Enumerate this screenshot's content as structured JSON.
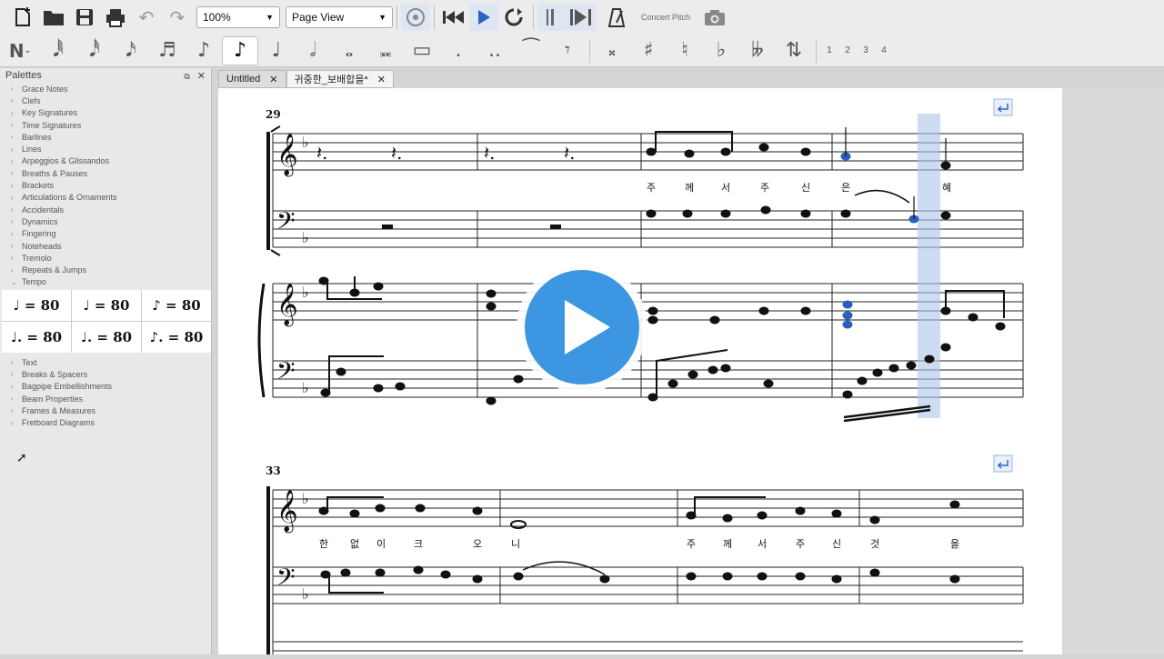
{
  "toolbar": {
    "zoom_value": "100%",
    "view_value": "Page View",
    "concert_pitch_label": "Concert Pitch",
    "voice_numbers": [
      "1",
      "2",
      "3",
      "4"
    ]
  },
  "palettes": {
    "title": "Palettes",
    "items_top": [
      "Grace Notes",
      "Clefs",
      "Key Signatures",
      "Time Signatures",
      "Barlines",
      "Lines",
      "Arpeggios & Glissandos",
      "Breaths & Pauses",
      "Brackets",
      "Articulations & Ornaments",
      "Accidentals",
      "Dynamics",
      "Fingering",
      "Noteheads",
      "Tremolo",
      "Repeats & Jumps"
    ],
    "expanded_item": "Tempo",
    "tempo_cells": [
      "♩ = 80",
      "♩ = 80",
      "♪ = 80",
      "♩. = 80",
      "♩. = 80",
      "♪. = 80"
    ],
    "items_bottom": [
      "Text",
      "Breaks & Spacers",
      "Bagpipe Embellishments",
      "Beam Properties",
      "Frames & Measures",
      "Fretboard Diagrams"
    ]
  },
  "tabs": [
    {
      "label": "Untitled"
    },
    {
      "label": "귀중한_보배합을*"
    }
  ],
  "score": {
    "system1_measure": "29",
    "system2_measure": "33",
    "lyrics1": [
      "주",
      "께",
      "서",
      "주",
      "신",
      "은",
      "혜"
    ],
    "lyrics2": [
      "한",
      "없",
      "이",
      "크",
      "오",
      "니",
      "주",
      "께",
      "서",
      "주",
      "신",
      "것",
      "을"
    ]
  },
  "colors": {
    "accent": "#3d96e2",
    "selection": "#aec4ea",
    "selected_note": "#2a5fbf"
  }
}
